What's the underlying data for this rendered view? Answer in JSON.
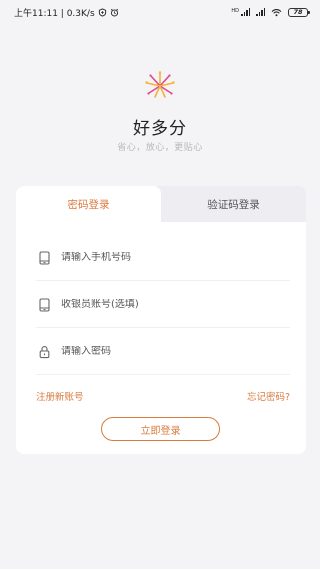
{
  "status_bar": {
    "time_speed": "上午11:11 | 0.3K/s",
    "network_label": "HD",
    "battery": "78"
  },
  "app": {
    "name": "好多分",
    "slogan": "省心，放心，更贴心"
  },
  "tabs": [
    {
      "label": "密码登录",
      "active": true
    },
    {
      "label": "验证码登录",
      "active": false
    }
  ],
  "form": {
    "phone_placeholder": "请输入手机号码",
    "cashier_placeholder": "收银员账号(选填)",
    "password_placeholder": "请输入密码"
  },
  "links": {
    "register": "注册新账号",
    "forgot": "忘记密码?"
  },
  "login_button": "立即登录",
  "colors": {
    "accent": "#d97a3e",
    "background": "#f4f3f6",
    "tab_inactive_bg": "#eeedf2"
  },
  "icons": {
    "logo": "firework-logo-icon",
    "phone": "phone-icon",
    "cashier": "cashier-account-icon",
    "password": "lock-icon"
  }
}
